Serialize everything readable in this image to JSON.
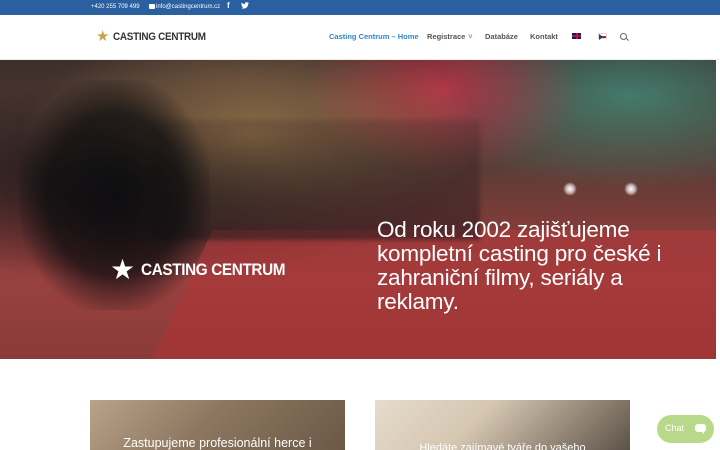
{
  "topbar": {
    "phone": "+420 255 709 499",
    "email": "info@castingcentrum.cz",
    "social": [
      "facebook-icon",
      "twitter-icon"
    ]
  },
  "header": {
    "logo_text": "CASTING CENTRUM",
    "nav": {
      "home": "Casting Centrum – Home",
      "registrace": "Registrace",
      "databaze": "Databáze",
      "kontakt": "Kontakt"
    },
    "languages": [
      "en-flag-icon",
      "cz-flag-icon"
    ],
    "accent_color": "#2a8ac8"
  },
  "hero": {
    "logo_text": "CASTING CENTRUM",
    "headline": "Od roku 2002 zajišťujeme kompletní casting pro české i zahraniční filmy, seriály a reklamy."
  },
  "cards": [
    {
      "caption": "Zastupujeme profesionální herce i"
    },
    {
      "caption": "Hledáte zajímavé tváře do vašeho"
    }
  ],
  "chat": {
    "label": "Chat",
    "color": "#b8d98a"
  }
}
